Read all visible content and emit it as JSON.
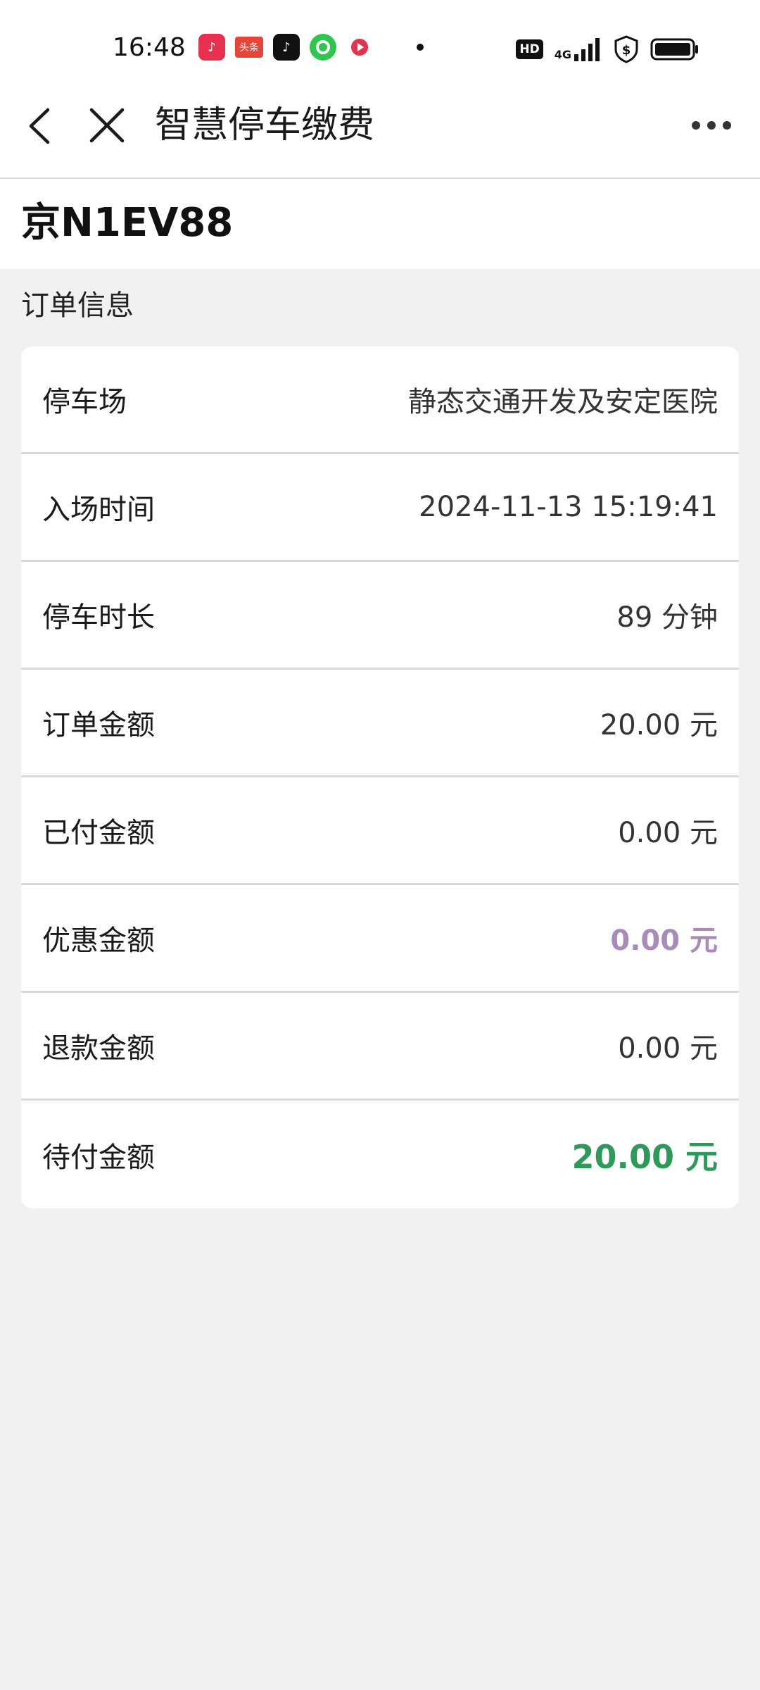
{
  "status_bar": {
    "time": "16:48",
    "hd_label": "HD",
    "network_label": "4G",
    "notification_icons": [
      "music-app-icon",
      "toutiao-app-icon",
      "tiktok-app-icon",
      "wechat-app-icon",
      "video-app-icon"
    ],
    "toutiao_label": "头条"
  },
  "nav": {
    "title": "智慧停车缴费"
  },
  "plate": {
    "number": "京N1EV88"
  },
  "order": {
    "section_title": "订单信息",
    "rows": [
      {
        "label": "停车场",
        "value": "静态交通开发及安定医院"
      },
      {
        "label": "入场时间",
        "value": "2024-11-13 15:19:41"
      },
      {
        "label": "停车时长",
        "value": "89 分钟"
      },
      {
        "label": "订单金额",
        "value": "20.00 元"
      },
      {
        "label": "已付金额",
        "value": "0.00 元"
      },
      {
        "label": "优惠金额",
        "value": "0.00 元"
      },
      {
        "label": "退款金额",
        "value": "0.00 元"
      },
      {
        "label": "待付金额",
        "value": "20.00 元"
      }
    ]
  },
  "colors": {
    "discount": "#a88bb8",
    "due": "#2e9a5a",
    "background": "#f1f1f1"
  }
}
